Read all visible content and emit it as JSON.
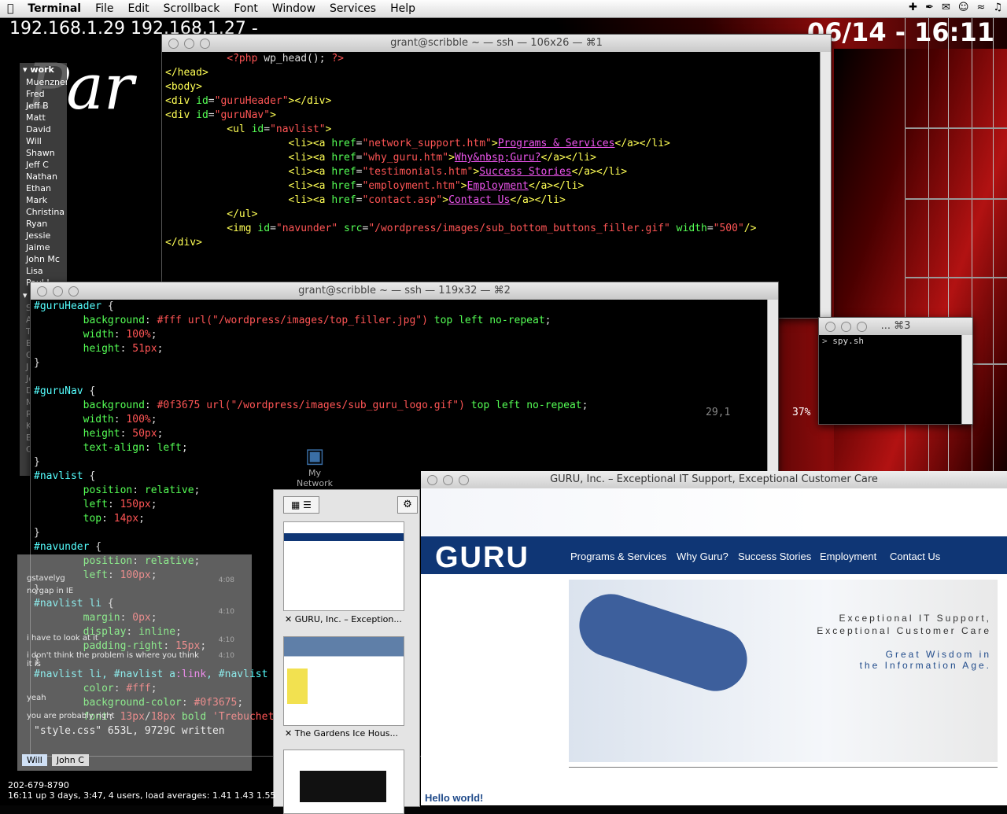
{
  "menubar": {
    "app": "Terminal",
    "items": [
      "File",
      "Edit",
      "Scrollback",
      "Font",
      "Window",
      "Services",
      "Help"
    ]
  },
  "desktop": {
    "ip_text": "192.168.1.29  192.168.1.27 -",
    "clock": "06/14 - 16:11",
    "phone": "202-679-8790",
    "uptime": "16:11  up 3 days,  3:47, 4 users, load averages: 1.41 1.43 1.55",
    "network_icon_label": "My Network"
  },
  "buddy_list": {
    "group_online": "work",
    "online": [
      "Muenzner",
      "Fred",
      "Jeff B",
      "Matt",
      "David",
      "Will",
      "Shawn",
      "Jeff C",
      "Nathan",
      "Ethan",
      "Mark",
      "Christina",
      "Ryan",
      "Jessie",
      "Jaime",
      "John Mc",
      "Lisa",
      "Paul L"
    ],
    "offline": [
      "SeanMc",
      "Aaron",
      "Thai",
      "Bill",
      "Grant",
      "J",
      "John C",
      "Dave H",
      "Meghan",
      "Rick",
      "Kru",
      "Bryan",
      "Cody"
    ]
  },
  "term1": {
    "title": "grant@scribble ~ — ssh — 106x26 — ⌘1"
  },
  "term2": {
    "title": "grant@scribble ~ — ssh — 119x32 — ⌘2",
    "status": "\"style.css\" 653L, 9729C written",
    "cursor_pos": "29,1",
    "percent": "37%"
  },
  "term3": {
    "title": "... ⌘3",
    "prompt": "spy.sh"
  },
  "chat": {
    "lines": [
      "gstavelyg",
      "no gap in IE",
      "i have to look at it",
      "i don't think the problem is where you think it is",
      "yeah",
      "you are probably right"
    ],
    "times": [
      "4:08",
      "4:10",
      "4:10",
      "4:10"
    ],
    "tabs": [
      "Will",
      "John C"
    ]
  },
  "drawer": {
    "items": [
      "GURU, Inc. – Exception...",
      "The Gardens Ice Hous..."
    ]
  },
  "safari": {
    "title": "GURU, Inc. – Exceptional IT Support, Exceptional Customer Care",
    "logo": "GURU",
    "nav": [
      "Programs & Services",
      "Why Guru?",
      "Success Stories",
      "Employment",
      "Contact Us"
    ],
    "tagline1": "Exceptional IT Support,",
    "tagline2": "Exceptional Customer Care",
    "tagline3": "Great Wisdom in",
    "tagline4": "the Information Age.",
    "post_title": "Hello world!"
  }
}
